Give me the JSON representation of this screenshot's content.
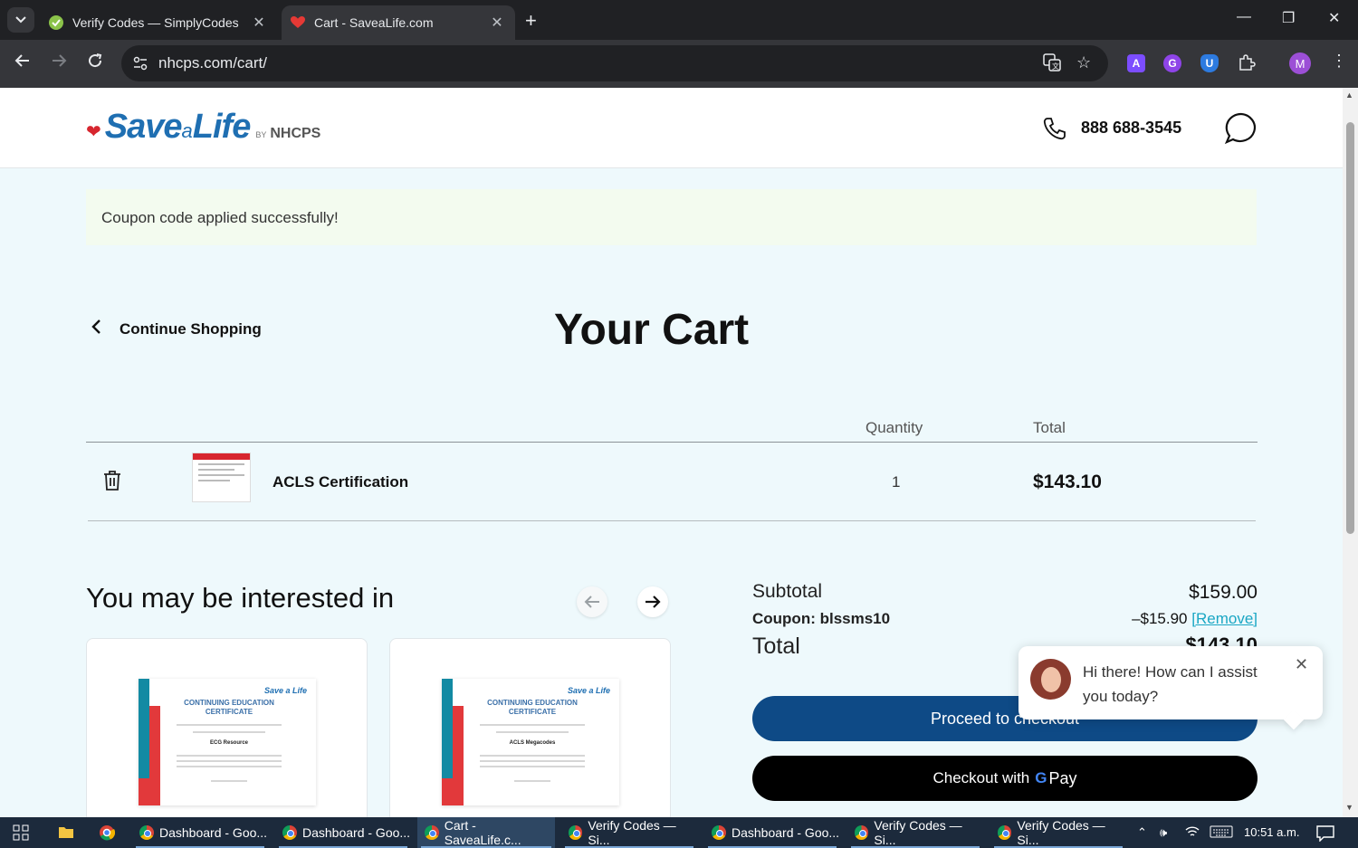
{
  "browser": {
    "tabs": [
      {
        "title": "Verify Codes — SimplyCodes",
        "icon": "simplycodes-icon",
        "active": false
      },
      {
        "title": "Cart - SaveaLife.com",
        "icon": "heart-icon",
        "active": true
      }
    ],
    "url": "nhcps.com/cart/",
    "profile_initial": "M",
    "extensions": [
      "A",
      "G",
      "U"
    ]
  },
  "header": {
    "logo_save": "Save",
    "logo_a": "a",
    "logo_life": "Life",
    "logo_by": "BY",
    "logo_nhcps": "NHCPS",
    "phone": "888 688-3545"
  },
  "notice": "Coupon code applied successfully!",
  "cart": {
    "continue_label": "Continue Shopping",
    "title": "Your Cart",
    "col_quantity": "Quantity",
    "col_total": "Total",
    "items": [
      {
        "name": "ACLS Certification",
        "quantity": "1",
        "total": "$143.10"
      }
    ]
  },
  "recommend": {
    "title": "You may be interested in",
    "cards": [
      {
        "brand": "Save a Life",
        "cert_title": "CONTINUING EDUCATION CERTIFICATE",
        "subject": "ECG Resource"
      },
      {
        "brand": "Save a Life",
        "cert_title": "CONTINUING EDUCATION CERTIFICATE",
        "subject": "ACLS Megacodes"
      }
    ]
  },
  "summary": {
    "subtotal_label": "Subtotal",
    "subtotal": "$159.00",
    "coupon_label": "Coupon: blssms10",
    "discount": "–$15.90",
    "remove_label": "[Remove]",
    "total_label": "Total",
    "total": "$143.10",
    "checkout_label": "Proceed to checkout",
    "gpay_label": "Checkout with",
    "gpay_g": "G",
    "gpay_pay": "Pay"
  },
  "chat": {
    "message": "Hi there! How can I assist you today?"
  },
  "taskbar": {
    "items": [
      {
        "label": "Dashboard - Goo...",
        "active": false
      },
      {
        "label": "Dashboard - Goo...",
        "active": false
      },
      {
        "label": "Cart - SaveaLife.c...",
        "active": true
      },
      {
        "label": "Verify Codes — Si...",
        "active": false
      },
      {
        "label": "Dashboard - Goo...",
        "active": false
      },
      {
        "label": "Verify Codes — Si...",
        "active": false
      },
      {
        "label": "Verify Codes — Si...",
        "active": false
      }
    ],
    "time": "10:51 a.m."
  },
  "colors": {
    "brand_blue": "#1f6fb2",
    "checkout_blue": "#0e4a86",
    "heart_red": "#d7262f",
    "link_teal": "#1aa7c4",
    "page_bg": "#eef9fc"
  }
}
